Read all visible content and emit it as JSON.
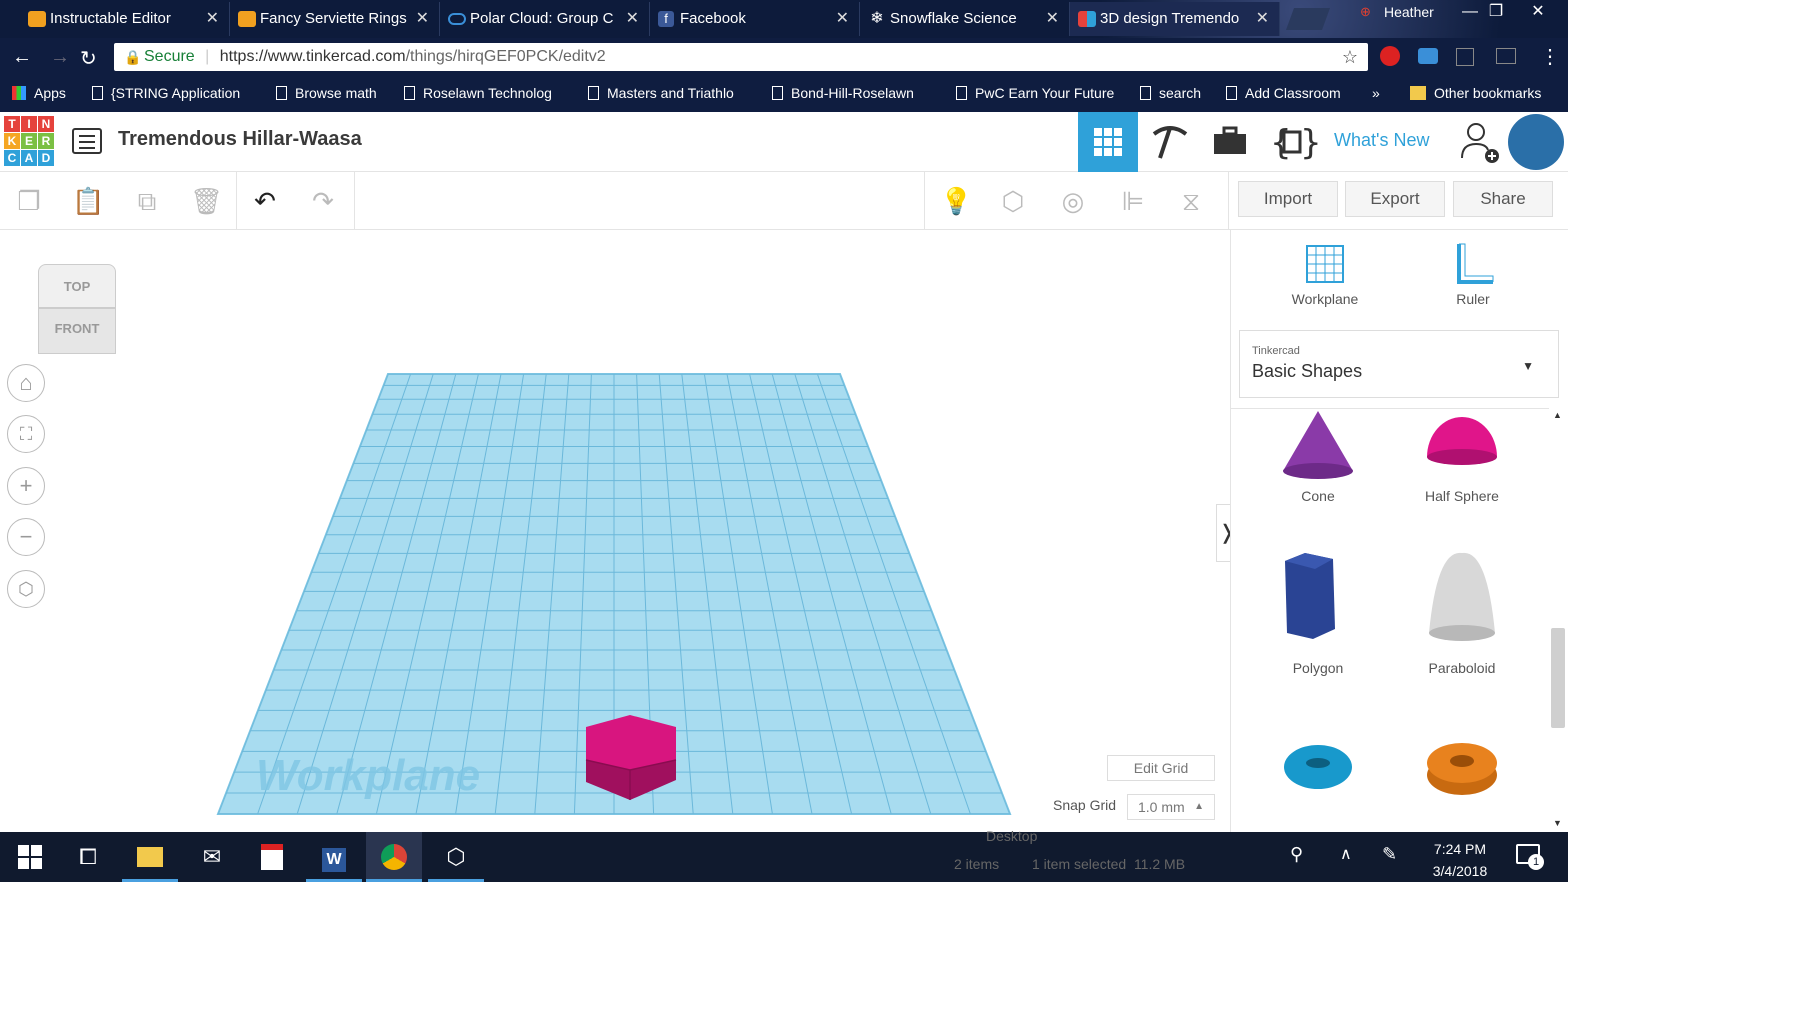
{
  "browser": {
    "tabs": [
      {
        "title": "Instructable Editor",
        "icon": "instructables-robot-icon",
        "color": "#f0a020"
      },
      {
        "title": "Fancy Serviette Rings",
        "icon": "instructables-robot-icon",
        "color": "#f0a020"
      },
      {
        "title": "Polar Cloud: Group C",
        "icon": "cloud-icon",
        "color": "#3a8fd8"
      },
      {
        "title": "Facebook",
        "icon": "facebook-icon",
        "color": "#3b5998"
      },
      {
        "title": "Snowflake Science",
        "icon": "snowflake-icon",
        "color": "#ffffff"
      },
      {
        "title": "3D design Tremendo",
        "icon": "tinkercad-icon",
        "color": "#e5423c"
      }
    ],
    "user": "Heather",
    "address": {
      "secure_label": "Secure",
      "host": "https://www.tinkercad.com",
      "path": "/things/hirqGEF0PCK/editv2"
    },
    "bookmarks": [
      "Apps",
      "{STRING Application",
      "Browse math",
      "Roselawn Technolog",
      "Masters and Triathlo",
      "Bond-Hill-Roselawn",
      "PwC Earn Your Future",
      "search",
      "Add Classroom",
      "»",
      "Other bookmarks"
    ]
  },
  "tinkercad": {
    "logo_letters": [
      "T",
      "I",
      "N",
      "K",
      "E",
      "R",
      "C",
      "A",
      "D"
    ],
    "project_title": "Tremendous Hillar-Waasa",
    "whats_new": "What's New",
    "toolbar": {
      "import": "Import",
      "export": "Export",
      "share": "Share"
    },
    "viewcube": {
      "top": "TOP",
      "front": "FRONT"
    },
    "workplane_label": "Workplane",
    "edit_grid": "Edit Grid",
    "snap_grid_label": "Snap Grid",
    "snap_grid_value": "1.0 mm",
    "panel": {
      "workplane": "Workplane",
      "ruler": "Ruler",
      "library_category": "Tinkercad",
      "library_name": "Basic Shapes",
      "shapes": [
        {
          "name": "Cone",
          "color": "#8a3aa8"
        },
        {
          "name": "Half Sphere",
          "color": "#e0158a"
        },
        {
          "name": "Polygon",
          "color": "#2a4494"
        },
        {
          "name": "Paraboloid",
          "color": "#d8d8d8"
        },
        {
          "name": "",
          "color": "#1899cc"
        },
        {
          "name": "",
          "color": "#e8821e"
        }
      ]
    },
    "colors": {
      "workplane": "#a8dcf0",
      "hexagon": "#d8157f",
      "accent": "#2fa1d9"
    }
  },
  "taskbar": {
    "time": "7:24 PM",
    "date": "3/4/2018",
    "explorer_items": "2 items",
    "explorer_selected": "1 item selected  11.2 MB",
    "explorer_folder": "Desktop",
    "notifications": "1"
  }
}
